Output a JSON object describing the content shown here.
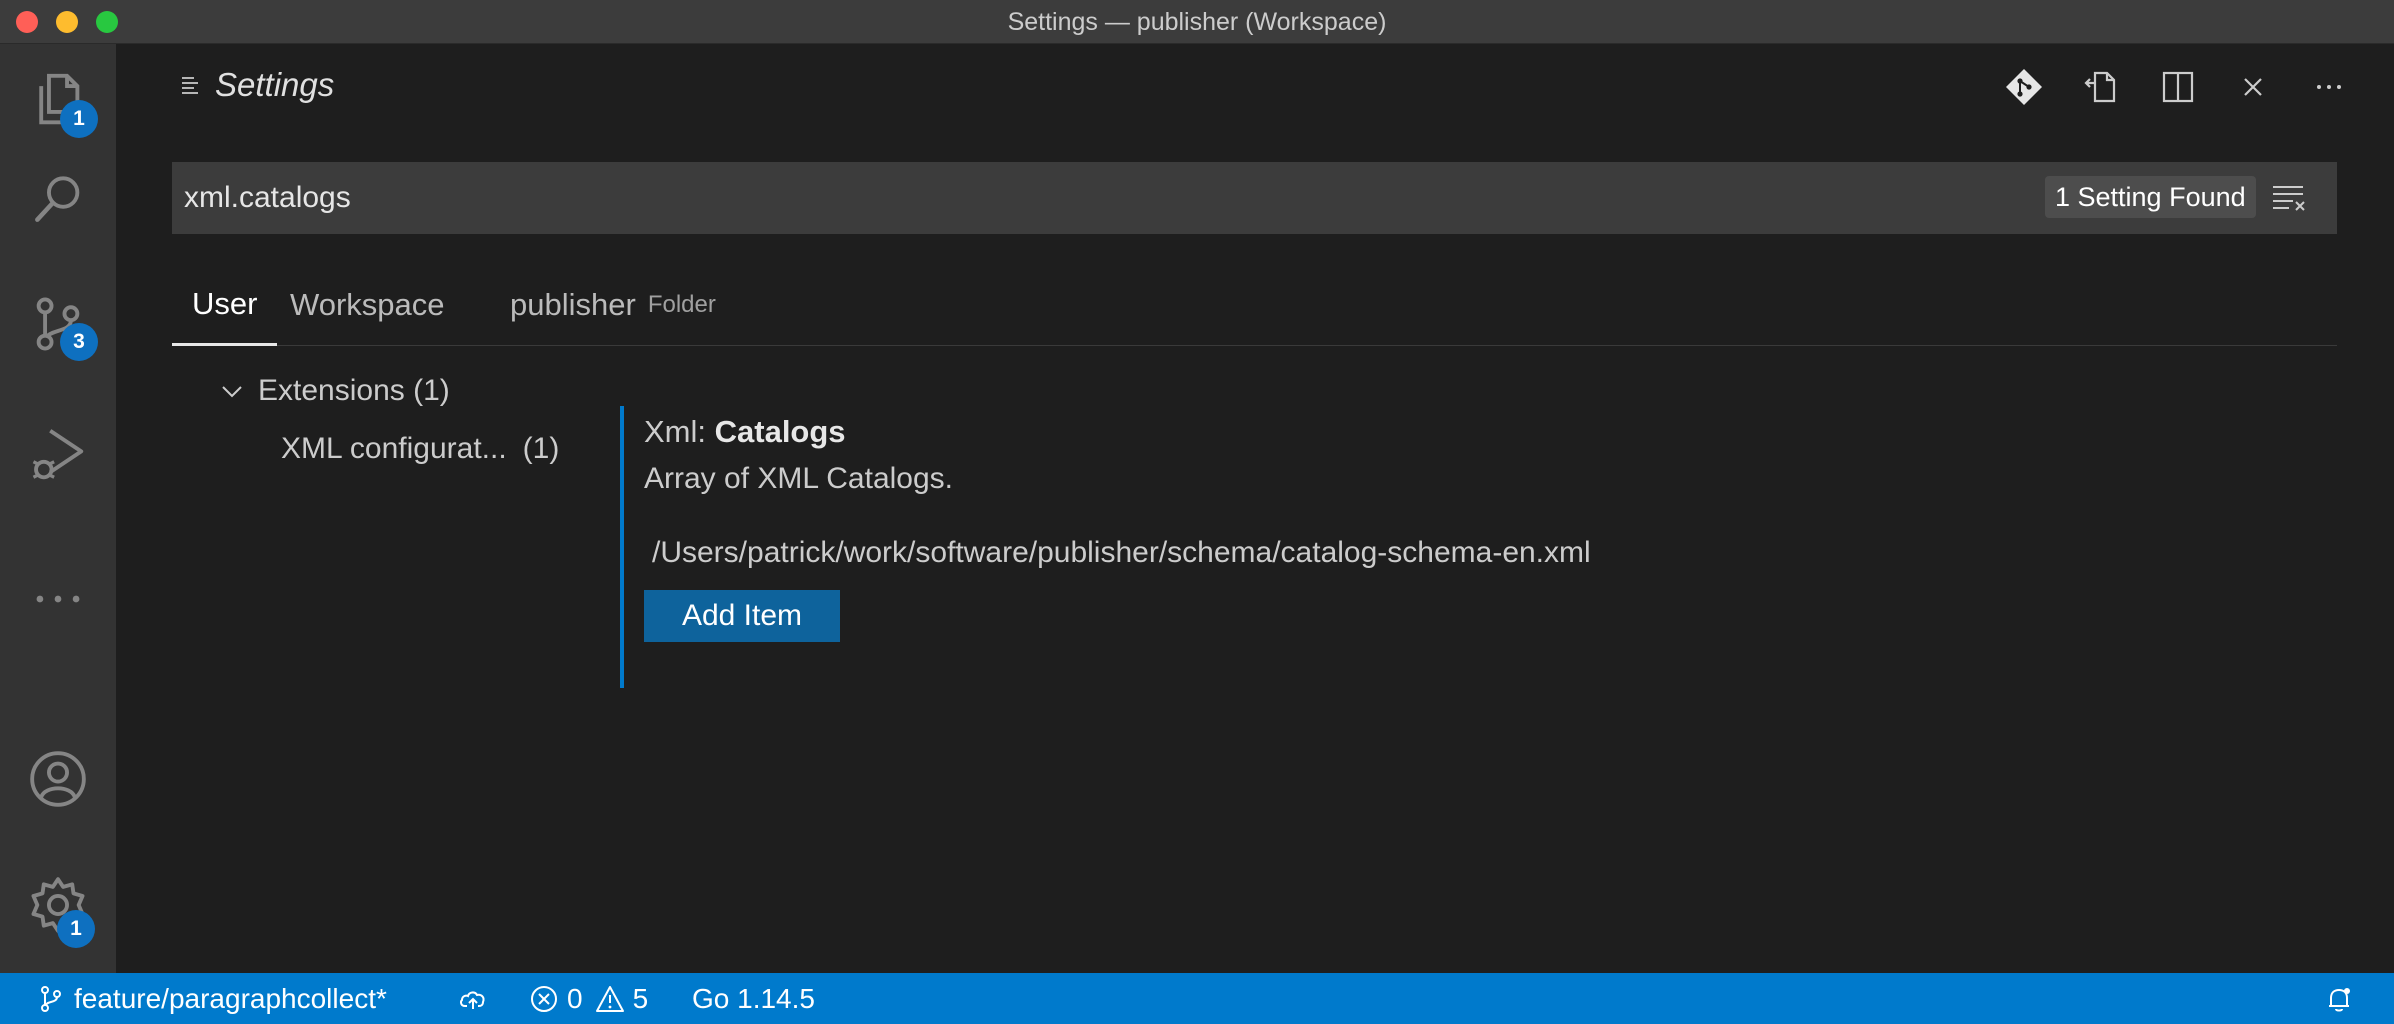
{
  "window": {
    "title": "Settings — publisher (Workspace)"
  },
  "activity_bar": {
    "explorer_badge": "1",
    "source_control_badge": "3",
    "manage_badge": "1"
  },
  "editor": {
    "title": "Settings",
    "search": {
      "value": "xml.catalogs",
      "result_count": "1 Setting Found"
    },
    "scope_tabs": [
      {
        "label": "User",
        "active": true
      },
      {
        "label": "Workspace"
      },
      {
        "label": "publisher",
        "hint": "Folder"
      }
    ],
    "toc": {
      "group": "Extensions (1)",
      "item_label": "XML configurat...",
      "item_count": "(1)"
    },
    "setting": {
      "category": "Xml: ",
      "label": "Catalogs",
      "description": "Array of XML Catalogs.",
      "values": [
        "/Users/patrick/work/software/publisher/schema/catalog-schema-en.xml"
      ],
      "add_button": "Add Item"
    }
  },
  "status_bar": {
    "branch": "feature/paragraphcollect*",
    "errors": "0",
    "warnings": "5",
    "go_version": "Go 1.14.5"
  },
  "colors": {
    "accent": "#007acc",
    "badge": "#0e70c0",
    "button": "#0e639c",
    "activity_bar": "#333333",
    "editor_bg": "#1e1e1e"
  }
}
